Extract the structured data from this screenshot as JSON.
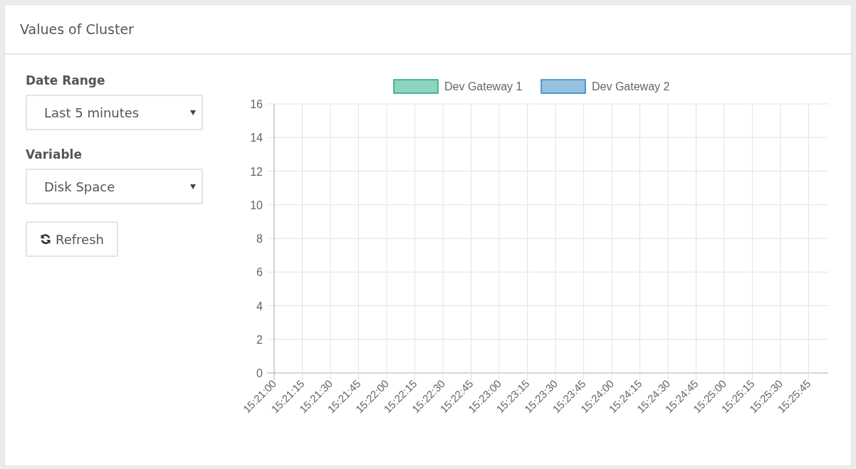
{
  "panel": {
    "title": "Values of Cluster"
  },
  "filters": [
    {
      "label": "Date Range",
      "value": "Last 5 minutes"
    },
    {
      "label": "Variable",
      "value": "Disk Space"
    }
  ],
  "refresh_button": {
    "label": "Refresh"
  },
  "chart": {
    "chart_data": {
      "type": "line",
      "categories": [
        "15:21:00",
        "15:21:15",
        "15:21:30",
        "15:21:45",
        "15:22:00",
        "15:22:15",
        "15:22:30",
        "15:22:45",
        "15:23:00",
        "15:23:15",
        "15:23:30",
        "15:23:45",
        "15:24:00",
        "15:24:15",
        "15:24:30",
        "15:24:45",
        "15:25:00",
        "15:25:15",
        "15:25:30",
        "15:25:45"
      ],
      "series": [
        {
          "name": "Dev Gateway 1",
          "color": "#1fa883",
          "values": [
            null,
            null,
            null,
            null,
            null,
            null,
            null,
            null,
            null,
            null,
            null,
            null,
            null,
            null,
            null,
            null,
            null,
            null,
            null,
            null
          ]
        },
        {
          "name": "Dev Gateway 2",
          "color": "#2f84c4",
          "values": [
            null,
            null,
            null,
            null,
            null,
            null,
            null,
            null,
            null,
            null,
            null,
            null,
            null,
            null,
            null,
            null,
            null,
            null,
            null,
            null
          ]
        }
      ],
      "grid": true,
      "ylim": [
        0,
        16
      ],
      "yticks": [
        0,
        2,
        4,
        6,
        8,
        10,
        12,
        14,
        16
      ]
    }
  }
}
